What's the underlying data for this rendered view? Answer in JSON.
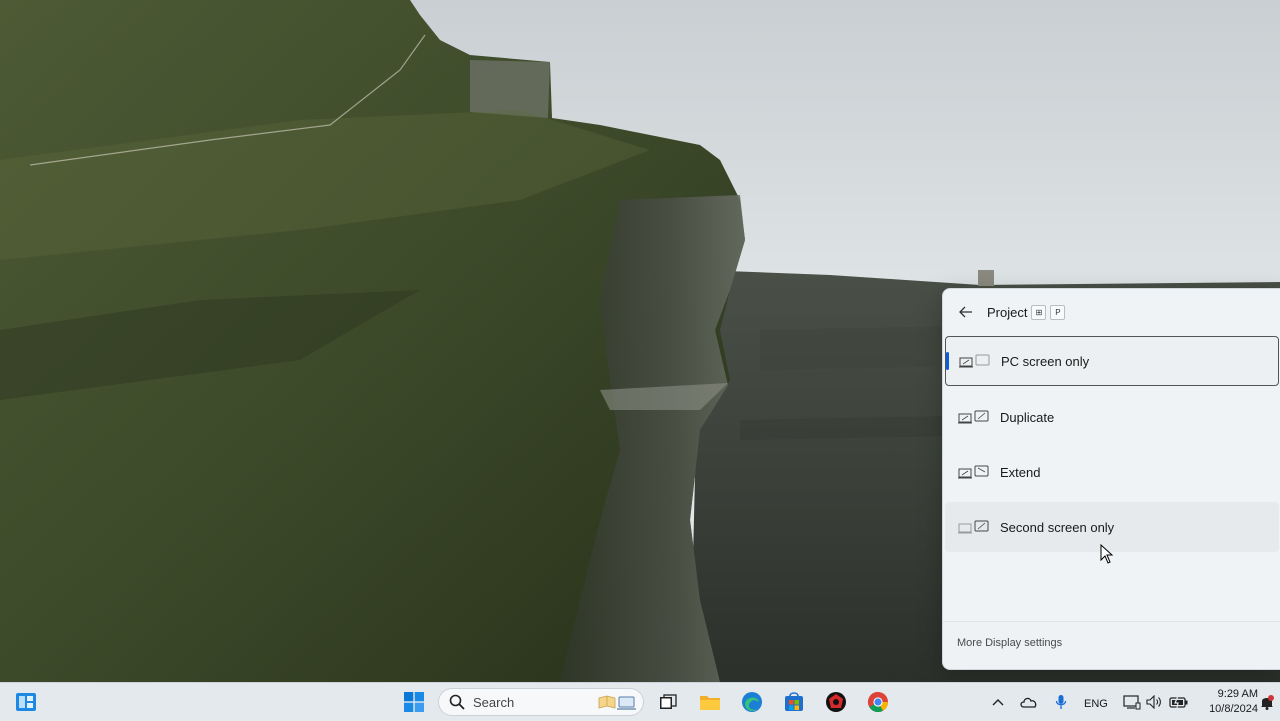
{
  "flyout": {
    "title": "Project",
    "shortcut_keys": [
      "⊞",
      "P"
    ],
    "options": [
      {
        "label": "PC screen only",
        "icon": "pc-screen-only-icon",
        "selected": true
      },
      {
        "label": "Duplicate",
        "icon": "duplicate-icon",
        "selected": false
      },
      {
        "label": "Extend",
        "icon": "extend-icon",
        "selected": false
      },
      {
        "label": "Second screen only",
        "icon": "second-screen-only-icon",
        "selected": false
      }
    ],
    "footer_link": "More Display settings"
  },
  "taskbar": {
    "search_placeholder": "Search",
    "language": "ENG",
    "time": "9:29 AM",
    "date": "10/8/2024"
  },
  "colors": {
    "accent": "#0a5ed7",
    "flyout_bg": "#eff3f6",
    "taskbar_bg": "#e4e9ee"
  }
}
